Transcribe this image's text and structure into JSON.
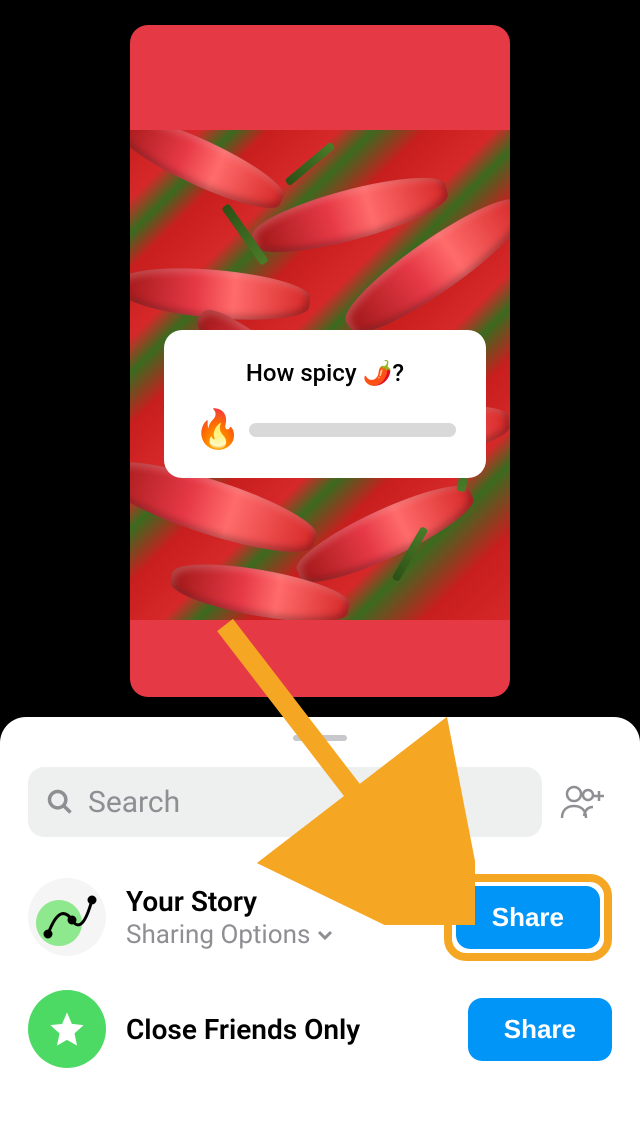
{
  "story": {
    "poll_question": "How spicy 🌶️?",
    "slider_emoji": "🔥"
  },
  "share_sheet": {
    "search_placeholder": "Search",
    "rows": [
      {
        "title": "Your Story",
        "subtitle": "Sharing Options",
        "button_label": "Share"
      },
      {
        "title": "Close Friends Only",
        "button_label": "Share"
      }
    ]
  },
  "colors": {
    "accent": "#0095f6",
    "highlight": "#f5a623",
    "story_bg": "#e63946",
    "close_friends": "#4cd964"
  }
}
